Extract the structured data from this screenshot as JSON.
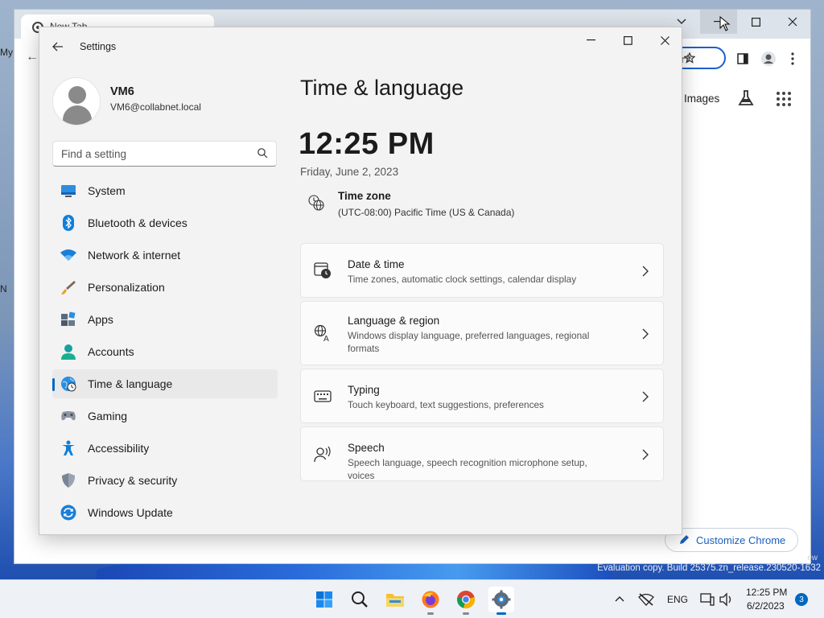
{
  "desktop": {
    "watermark_line1": "ew",
    "watermark_line2": "Evaluation copy. Build 25375.zn_release.230520-1632",
    "left_labels": [
      "My",
      "N"
    ]
  },
  "chrome": {
    "tab_title": "New Tab",
    "images_label": "Images",
    "customize_label": "Customize Chrome"
  },
  "settings": {
    "window_title": "Settings",
    "user": {
      "name": "VM6",
      "email": "VM6@collabnet.local"
    },
    "search_placeholder": "Find a setting",
    "nav": [
      {
        "label": "System",
        "icon": "system-icon"
      },
      {
        "label": "Bluetooth & devices",
        "icon": "bluetooth-icon"
      },
      {
        "label": "Network & internet",
        "icon": "wifi-icon"
      },
      {
        "label": "Personalization",
        "icon": "brush-icon"
      },
      {
        "label": "Apps",
        "icon": "apps-icon"
      },
      {
        "label": "Accounts",
        "icon": "accounts-icon"
      },
      {
        "label": "Time & language",
        "icon": "globe-clock-icon",
        "active": true
      },
      {
        "label": "Gaming",
        "icon": "gamepad-icon"
      },
      {
        "label": "Accessibility",
        "icon": "accessibility-icon"
      },
      {
        "label": "Privacy & security",
        "icon": "shield-icon"
      },
      {
        "label": "Windows Update",
        "icon": "update-icon"
      }
    ],
    "page_title": "Time & language",
    "time": "12:25 PM",
    "date": "Friday, June 2, 2023",
    "timezone": {
      "title": "Time zone",
      "value": "(UTC-08:00) Pacific Time (US & Canada)"
    },
    "cards": [
      {
        "title": "Date & time",
        "subtitle": "Time zones, automatic clock settings, calendar display",
        "icon": "calendar-clock-icon"
      },
      {
        "title": "Language & region",
        "subtitle": "Windows display language, preferred languages, regional formats",
        "icon": "language-icon"
      },
      {
        "title": "Typing",
        "subtitle": "Touch keyboard, text suggestions, preferences",
        "icon": "keyboard-icon"
      },
      {
        "title": "Speech",
        "subtitle": "Speech language, speech recognition microphone setup, voices",
        "icon": "speech-icon"
      }
    ],
    "accent_color": "#0067c0"
  },
  "taskbar": {
    "language": "ENG",
    "time": "12:25 PM",
    "date": "6/2/2023",
    "notification_count": "3"
  }
}
